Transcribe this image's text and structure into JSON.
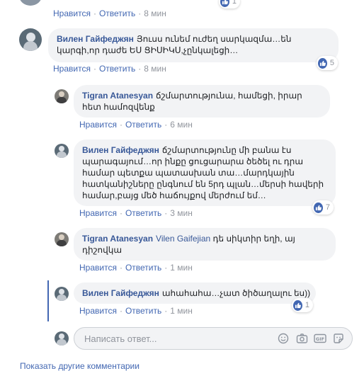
{
  "top_actions": {
    "like": "Нравится",
    "reply": "Ответить",
    "time": "8 мин"
  },
  "comments": [
    {
      "author": "Вилен Гайфеджян",
      "text": "Յուսս ունեմ ուժեղ սարկազմա…են կարգի,որ դաժե ԵՍ ՑԻՍԻԿՍ,չընկալեցի…",
      "like": "Нравится",
      "reply": "Ответить",
      "time": "8 мин",
      "reactions": "5"
    },
    {
      "author": "Tigran Atanesyan",
      "text": "ճշմարտությունա, համեցի, իրար հետ համոզվենք",
      "like": "Нравится",
      "reply": "Ответить",
      "time": "6 мин"
    },
    {
      "author": "Вилен Гайфеджян",
      "text": "ճշմարտությունը մի բանա էս պարագայում…որ ինքը ցուցարարա ծեծել ու դրա համար պետքա պատասխան տա…մարդկային հատկանիշները ընգնում են 5րդ պլան…մերսի հավերի համար,բայց մեծ հաճույքով մերժում եմ…",
      "like": "Нравится",
      "reply": "Ответить",
      "time": "3 мин",
      "reactions": "7"
    },
    {
      "author": "Tigran Atanesyan",
      "mention": "Vilen Gaifejian",
      "text": "դե սիկտիր եղի, այ դիշովկա",
      "like": "Нравится",
      "reply": "Ответить",
      "time": "1 мин"
    },
    {
      "author": "Вилен Гайфеджян",
      "text": "ահահահա…չատ ծիծաղալու ես))",
      "like": "Нравится",
      "reply": "Ответить",
      "time": "1 мин",
      "reactions": "1"
    }
  ],
  "composer": {
    "placeholder": "Написать ответ..."
  },
  "footer": {
    "text": "Показать другие комментарии"
  },
  "colors": {
    "link": "#4267b2",
    "author": "#385898",
    "bubble": "#f2f3f5"
  }
}
